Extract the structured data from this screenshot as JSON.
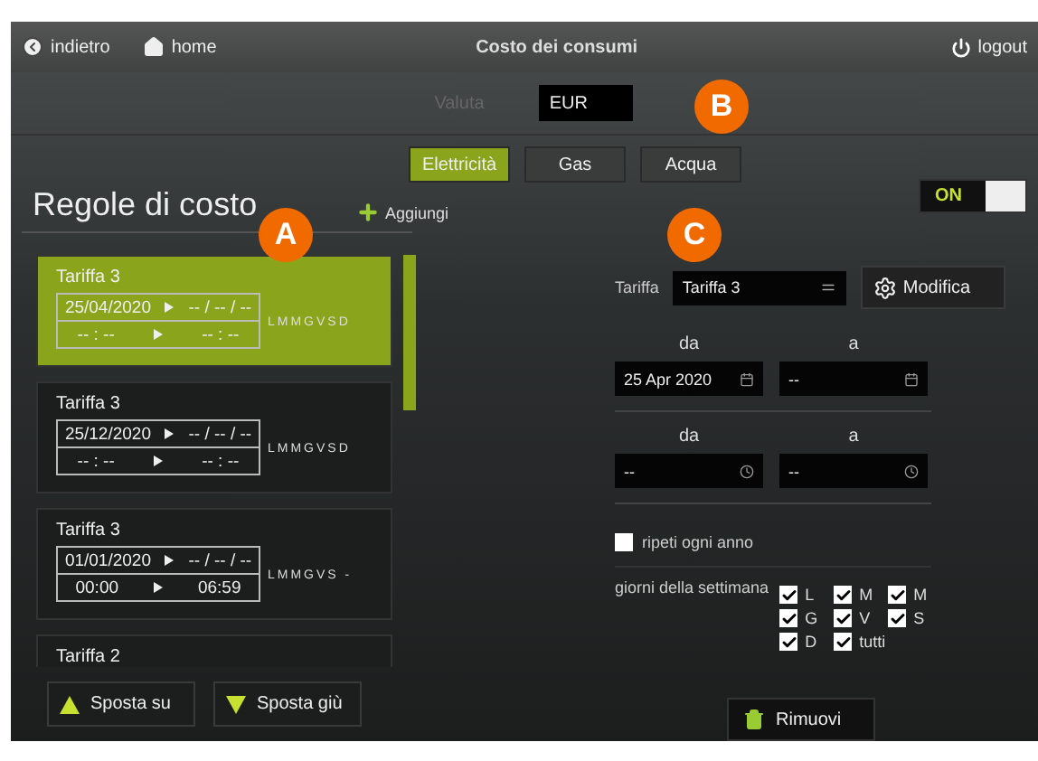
{
  "top_bar": {
    "back": "indietro",
    "home": "home",
    "title": "Costo dei consumi",
    "logout": "logout"
  },
  "currency": {
    "label": "Valuta",
    "value": "EUR"
  },
  "tabs": [
    {
      "label": "Elettricità",
      "selected": true
    },
    {
      "label": "Gas",
      "selected": false
    },
    {
      "label": "Acqua",
      "selected": false
    }
  ],
  "markers": [
    {
      "letter": "A"
    },
    {
      "letter": "B"
    },
    {
      "letter": "C"
    }
  ],
  "rules": {
    "title": "Regole di costo",
    "add": "Aggiungi",
    "items": [
      {
        "name": "Tariffa 3",
        "date_from": "25/04/2020",
        "date_to": "-- / -- / --",
        "time_from": "-- : --",
        "time_to": "-- : --",
        "days": "LMMGVSD",
        "selected": true
      },
      {
        "name": "Tariffa 3",
        "date_from": "25/12/2020",
        "date_to": "-- / -- / --",
        "time_from": "-- : --",
        "time_to": "-- : --",
        "days": "LMMGVSD",
        "selected": false
      },
      {
        "name": "Tariffa 3",
        "date_from": "01/01/2020",
        "date_to": "-- / -- / --",
        "time_from": "00:00",
        "time_to": "06:59",
        "days": "LMMGVS -",
        "selected": false
      },
      {
        "name": "Tariffa 2",
        "selected": false
      }
    ],
    "move_up": "Sposta su",
    "move_down": "Sposta giù"
  },
  "editor": {
    "toggle": {
      "label": "ON",
      "on": true
    },
    "tariff_label": "Tariffa",
    "tariff_value": "Tariffa 3",
    "edit": "Modifica",
    "date_from_label": "da",
    "date_to_label": "a",
    "date_from": "25 Apr 2020",
    "date_to": "--",
    "time_from_label": "da",
    "time_to_label": "a",
    "time_from": "--",
    "time_to": "--",
    "repeat": {
      "label": "ripeti ogni anno",
      "checked": false
    },
    "weekdays_label": "giorni della settimana",
    "weekdays": [
      {
        "label": "L",
        "checked": true
      },
      {
        "label": "M",
        "checked": true
      },
      {
        "label": "M",
        "checked": true
      },
      {
        "label": "G",
        "checked": true
      },
      {
        "label": "V",
        "checked": true
      },
      {
        "label": "S",
        "checked": true
      },
      {
        "label": "D",
        "checked": true
      },
      {
        "label": "tutti",
        "checked": true
      }
    ],
    "remove": "Rimuovi"
  }
}
